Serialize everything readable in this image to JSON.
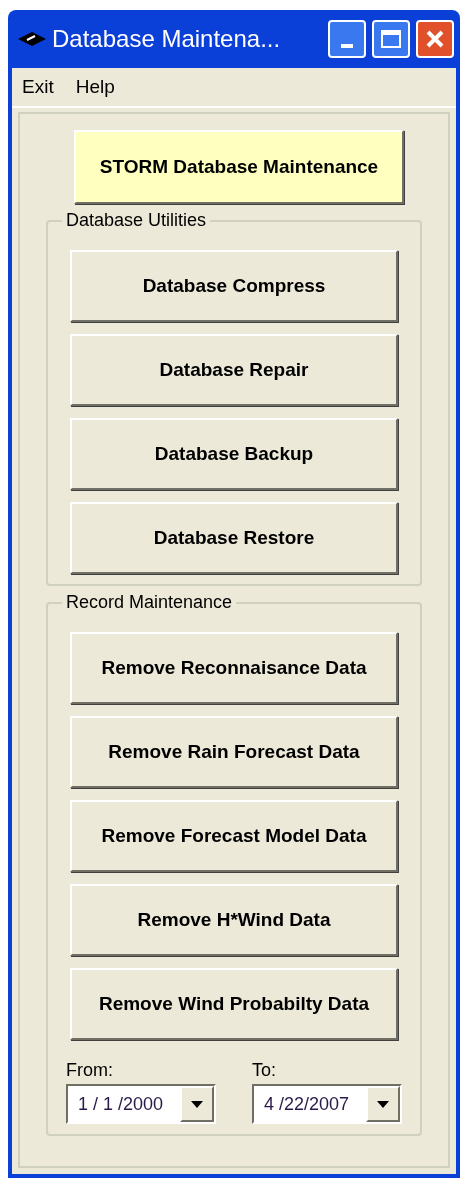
{
  "window": {
    "title": "Database Maintena..."
  },
  "menu": [
    "Exit",
    "Help"
  ],
  "header_button": "STORM Database Maintenance",
  "groups": [
    {
      "title": "Database Utilities",
      "buttons": [
        "Database Compress",
        "Database Repair",
        "Database Backup",
        "Database Restore"
      ]
    },
    {
      "title": "Record Maintenance",
      "buttons": [
        "Remove Reconnaisance Data",
        "Remove Rain Forecast Data",
        "Remove Forecast Model Data",
        "Remove H*Wind Data",
        "Remove Wind Probabilty Data"
      ]
    }
  ],
  "dates": [
    {
      "label": "From:",
      "value": "1 / 1 /2000"
    },
    {
      "label": "To:",
      "value": "4 /22/2007"
    }
  ]
}
